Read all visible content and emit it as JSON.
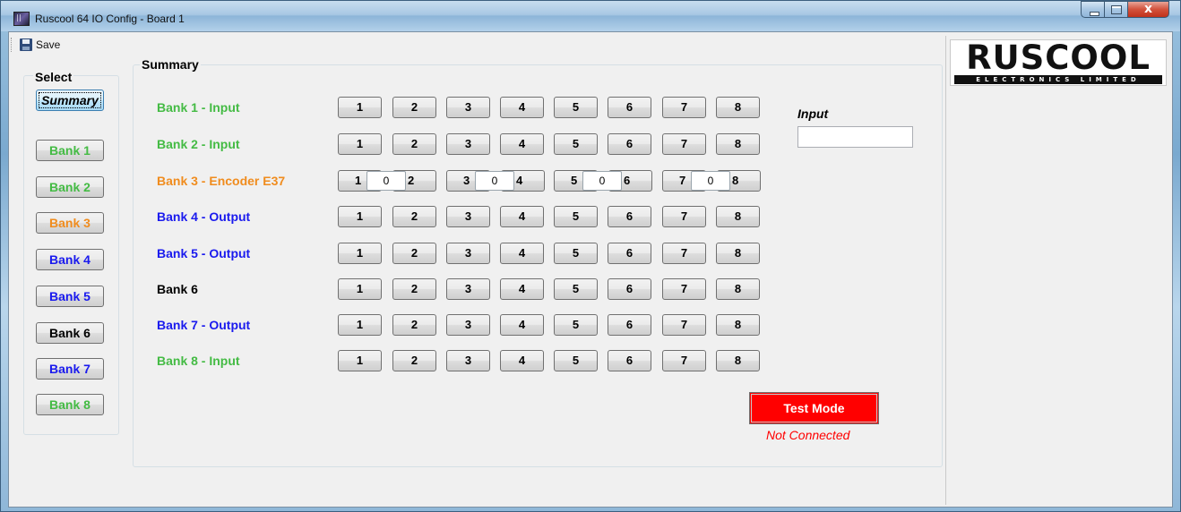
{
  "window": {
    "title": "Ruscool 64 IO Config - Board 1"
  },
  "toolbar": {
    "save_label": "Save"
  },
  "select": {
    "legend": "Select",
    "items": [
      {
        "label": "Summary",
        "color": "#000000",
        "active": true
      },
      {
        "label": "Bank 1",
        "color": "#44bb44"
      },
      {
        "label": "Bank 2",
        "color": "#44bb44"
      },
      {
        "label": "Bank 3",
        "color": "#f08c1e"
      },
      {
        "label": "Bank 4",
        "color": "#1a1aee"
      },
      {
        "label": "Bank 5",
        "color": "#1a1aee"
      },
      {
        "label": "Bank 6",
        "color": "#000000"
      },
      {
        "label": "Bank 7",
        "color": "#1a1aee"
      },
      {
        "label": "Bank 8",
        "color": "#44bb44"
      }
    ]
  },
  "summary": {
    "legend": "Summary",
    "banks": [
      {
        "label": "Bank 1 - Input",
        "color": "#44bb44",
        "type": "io",
        "channels": [
          "1",
          "2",
          "3",
          "4",
          "5",
          "6",
          "7",
          "8"
        ]
      },
      {
        "label": "Bank 2 - Input",
        "color": "#44bb44",
        "type": "io",
        "channels": [
          "1",
          "2",
          "3",
          "4",
          "5",
          "6",
          "7",
          "8"
        ]
      },
      {
        "label": "Bank 3 - Encoder E37",
        "color": "#f08c1e",
        "type": "encoder",
        "pairs": [
          {
            "a": "1",
            "b": "2",
            "value": "0"
          },
          {
            "a": "3",
            "b": "4",
            "value": "0"
          },
          {
            "a": "5",
            "b": "6",
            "value": "0"
          },
          {
            "a": "7",
            "b": "8",
            "value": "0"
          }
        ]
      },
      {
        "label": "Bank 4 - Output",
        "color": "#1a1aee",
        "type": "io",
        "channels": [
          "1",
          "2",
          "3",
          "4",
          "5",
          "6",
          "7",
          "8"
        ]
      },
      {
        "label": "Bank 5 - Output",
        "color": "#1a1aee",
        "type": "io",
        "channels": [
          "1",
          "2",
          "3",
          "4",
          "5",
          "6",
          "7",
          "8"
        ]
      },
      {
        "label": "Bank 6",
        "color": "#000000",
        "type": "io",
        "channels": [
          "1",
          "2",
          "3",
          "4",
          "5",
          "6",
          "7",
          "8"
        ]
      },
      {
        "label": "Bank 7 - Output",
        "color": "#1a1aee",
        "type": "io",
        "channels": [
          "1",
          "2",
          "3",
          "4",
          "5",
          "6",
          "7",
          "8"
        ]
      },
      {
        "label": "Bank 8 - Input",
        "color": "#44bb44",
        "type": "io",
        "channels": [
          "1",
          "2",
          "3",
          "4",
          "5",
          "6",
          "7",
          "8"
        ]
      }
    ],
    "input_label": "Input",
    "input_value": "",
    "test_mode_label": "Test Mode",
    "test_mode_color": "#ff0000",
    "connection_status": "Not Connected"
  },
  "logo": {
    "main": "RUSCOOL",
    "sub": "ELECTRONICS LIMITED"
  }
}
